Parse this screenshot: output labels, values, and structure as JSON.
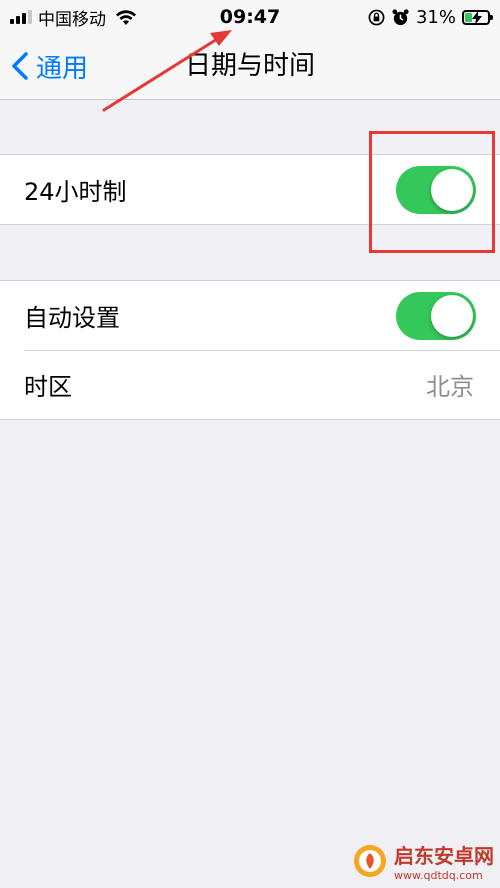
{
  "status_bar": {
    "carrier": "中国移动",
    "time": "09:47",
    "battery_percent": "31%",
    "battery_level": 0.31,
    "battery_color": "#34c759"
  },
  "nav": {
    "back_label": "通用",
    "title": "日期与时间",
    "accent_color": "#007aff"
  },
  "settings": {
    "group1": [
      {
        "label": "24小时制",
        "toggle_on": true
      }
    ],
    "group2": [
      {
        "label": "自动设置",
        "toggle_on": true
      },
      {
        "label": "时区",
        "value": "北京"
      }
    ]
  },
  "icons": [
    "signal-icon",
    "wifi-icon",
    "rotation-lock-icon",
    "alarm-icon",
    "battery-icon",
    "chevron-left-icon"
  ],
  "annotation_color": "#e53935",
  "watermark": {
    "name": "启东安卓网",
    "url": "www.qdtdq.com"
  }
}
